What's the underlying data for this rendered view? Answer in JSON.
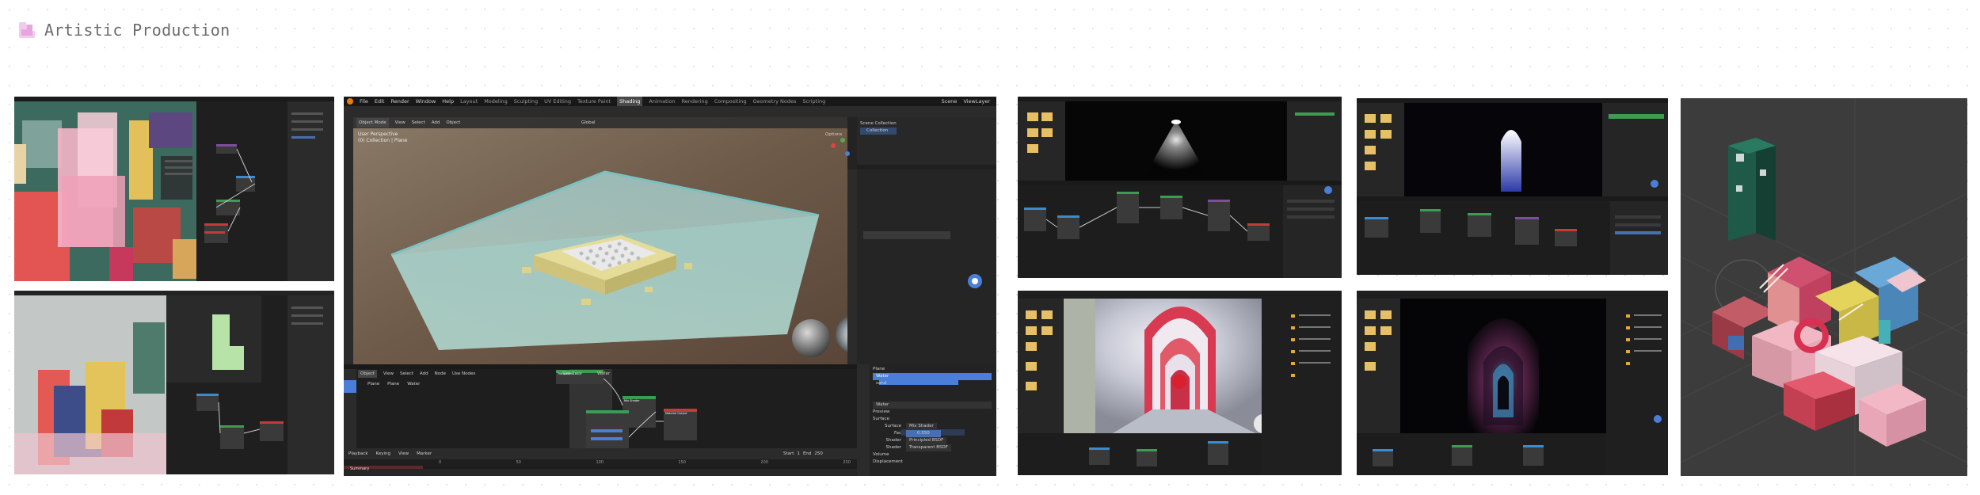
{
  "header": {
    "title": "Artistic Production"
  },
  "blender": {
    "menus": [
      "File",
      "Edit",
      "Render",
      "Window",
      "Help"
    ],
    "workspace_tabs": [
      "Layout",
      "Modeling",
      "Sculpting",
      "UV Editing",
      "Texture Paint",
      "Shading",
      "Animation",
      "Rendering",
      "Compositing",
      "Geometry Nodes",
      "Scripting"
    ],
    "active_tab": "Shading",
    "scene_label": "Scene",
    "view_layer_label": "ViewLayer",
    "viewport": {
      "mode": "Object Mode",
      "menus": [
        "View",
        "Select",
        "Add",
        "Object"
      ],
      "overlay_line1": "User Perspective",
      "overlay_line2": "(0) Collection | Plane",
      "shading": "Global",
      "options": "Options"
    },
    "outliner": {
      "root": "Scene Collection",
      "collection": "Collection"
    },
    "node_editor": {
      "mode": "Object",
      "menus": [
        "View",
        "Select",
        "Add",
        "Node"
      ],
      "use_nodes": "Use Nodes",
      "slot": "Slot 1",
      "material": "Water",
      "breadcrumb": [
        "Plane",
        "Plane",
        "Water"
      ],
      "nodes": {
        "transparent": "Transparent BSDF",
        "mix": "Mix Shader",
        "output": "Material Output"
      }
    },
    "properties": {
      "object": "Plane",
      "material": "Water",
      "slots": [
        "Water",
        "sand"
      ],
      "sections": [
        "Preview",
        "Surface"
      ],
      "surface_label": "Surface",
      "surface_value": "Mix Shader",
      "fac_label": "Fac",
      "fac_value": "0.550",
      "shader_label": "Shader",
      "shader1": "Principled BSDF",
      "shader2": "Transparent BSDF",
      "more_sections": [
        "Volume",
        "Displacement"
      ]
    },
    "timeline": {
      "menus": [
        "Playback",
        "Keying",
        "View",
        "Marker"
      ],
      "start_label": "Start",
      "start": "1",
      "end_label": "End",
      "end": "250",
      "ticks": [
        "0",
        "50",
        "100",
        "150",
        "200",
        "250"
      ],
      "summary": "Summary"
    }
  }
}
